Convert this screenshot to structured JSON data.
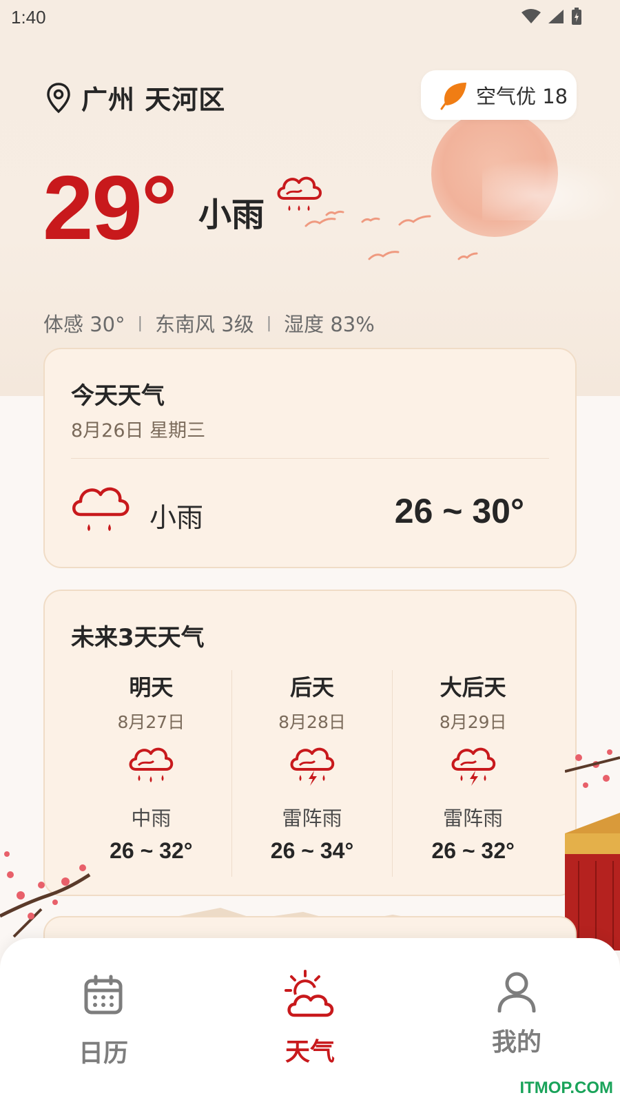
{
  "status": {
    "time": "1:40"
  },
  "location": {
    "name": "广州 天河区"
  },
  "aqi": {
    "label": "空气优 18"
  },
  "current": {
    "temperature": "29°",
    "condition": "小雨",
    "feels_like": "体感 30°",
    "wind": "东南风 3级",
    "humidity": "湿度 83%",
    "separator": "|"
  },
  "today": {
    "title": "今天天气",
    "date": "8月26日 星期三",
    "condition": "小雨",
    "range": "26 ~ 30°"
  },
  "forecast": {
    "title": "未来3天天气",
    "days": [
      {
        "name": "明天",
        "date": "8月27日",
        "condition": "中雨",
        "range": "26 ~ 32°",
        "icon": "rain-icon"
      },
      {
        "name": "后天",
        "date": "8月28日",
        "condition": "雷阵雨",
        "range": "26 ~ 34°",
        "icon": "thunderstorm-icon"
      },
      {
        "name": "大后天",
        "date": "8月29日",
        "condition": "雷阵雨",
        "range": "26 ~ 32°",
        "icon": "thunderstorm-icon"
      }
    ]
  },
  "nav": {
    "calendar": "日历",
    "weather": "天气",
    "me": "我的",
    "active": "weather"
  },
  "watermark": "ITMOP.COM",
  "colors": {
    "accent": "#c8191c",
    "card_bg": "#fcf1e6",
    "leaf": "#f07d14"
  }
}
